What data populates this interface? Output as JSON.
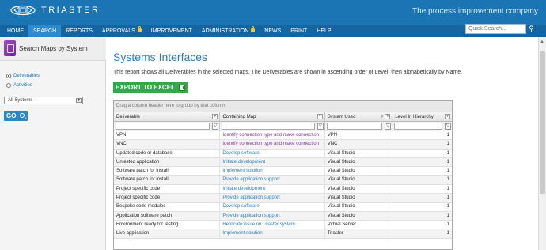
{
  "header": {
    "brand": "TRIASTER",
    "tagline": "The process improvement company"
  },
  "nav": {
    "items": [
      {
        "label": "HOME",
        "active": false,
        "locked": false
      },
      {
        "label": "SEARCH",
        "active": true,
        "locked": false
      },
      {
        "label": "REPORTS",
        "active": false,
        "locked": false
      },
      {
        "label": "APPROVALS",
        "active": false,
        "locked": true
      },
      {
        "label": "IMPROVEMENT",
        "active": false,
        "locked": false
      },
      {
        "label": "ADMINISTRATION",
        "active": false,
        "locked": true
      },
      {
        "label": "NEWS",
        "active": false,
        "locked": false
      },
      {
        "label": "PRINT",
        "active": false,
        "locked": false
      },
      {
        "label": "HELP",
        "active": false,
        "locked": false
      }
    ],
    "search_placeholder": "Quick Search..."
  },
  "sidebar": {
    "title": "Search Maps by System",
    "radio_deliverables": "Deliverables",
    "radio_activities": "Activities",
    "select_value": "-All Systems-",
    "go_label": "GO"
  },
  "main": {
    "title": "Systems Interfaces",
    "description": "This report shows all Deliverables in the selected maps. The Deliverables are shown in ascending order of Level, then alphabetically by Name.",
    "export_label": "EXPORT TO EXCEL"
  },
  "grid": {
    "group_hint": "Drag a column header here to group by that column",
    "columns": [
      "Deliverable",
      "Containing Map",
      "System Used",
      "Level In Hierarchy"
    ],
    "rows": [
      {
        "deliverable": "VPN",
        "map": "Identify connection type and make connection",
        "map_color": "purple",
        "system": "VPN",
        "level": "1"
      },
      {
        "deliverable": "VNC",
        "map": "Identify connection type and make connection",
        "map_color": "purple",
        "system": "VNC",
        "level": "1"
      },
      {
        "deliverable": "Updated code or database",
        "map": "Develop software",
        "map_color": "blue",
        "system": "Visual Studio",
        "level": "1"
      },
      {
        "deliverable": "Untested application",
        "map": "Initiate development",
        "map_color": "blue",
        "system": "Visual Studio",
        "level": "1"
      },
      {
        "deliverable": "Software patch for install",
        "map": "Implement solution",
        "map_color": "blue",
        "system": "Visual Studio",
        "level": "1"
      },
      {
        "deliverable": "Software patch for install",
        "map": "Provide application support",
        "map_color": "blue",
        "system": "Visual Studio",
        "level": "1"
      },
      {
        "deliverable": "Project specific code",
        "map": "Initiate development",
        "map_color": "blue",
        "system": "Visual Studio",
        "level": "1"
      },
      {
        "deliverable": "Project specific code",
        "map": "Provide application support",
        "map_color": "blue",
        "system": "Visual Studio",
        "level": "1"
      },
      {
        "deliverable": "Bespoke code modules",
        "map": "Develop software",
        "map_color": "blue",
        "system": "Visual Studio",
        "level": "1"
      },
      {
        "deliverable": "Application software patch",
        "map": "Provide application support",
        "map_color": "blue",
        "system": "Visual Studio",
        "level": "1"
      },
      {
        "deliverable": "Environment ready for testing",
        "map": "Replicate issue on Triaster system",
        "map_color": "blue",
        "system": "Virtual Server",
        "level": "1"
      },
      {
        "deliverable": "Live application",
        "map": "Implement solution",
        "map_color": "blue",
        "system": "Triaster",
        "level": "1"
      }
    ]
  },
  "colors": {
    "topbar": "#1b75b4",
    "navbar": "#1565a0",
    "title_blue": "#2b7cbd",
    "export_green": "#35a84a",
    "link_purple": "#8e3aa7",
    "link_blue": "#2c7fc0"
  }
}
